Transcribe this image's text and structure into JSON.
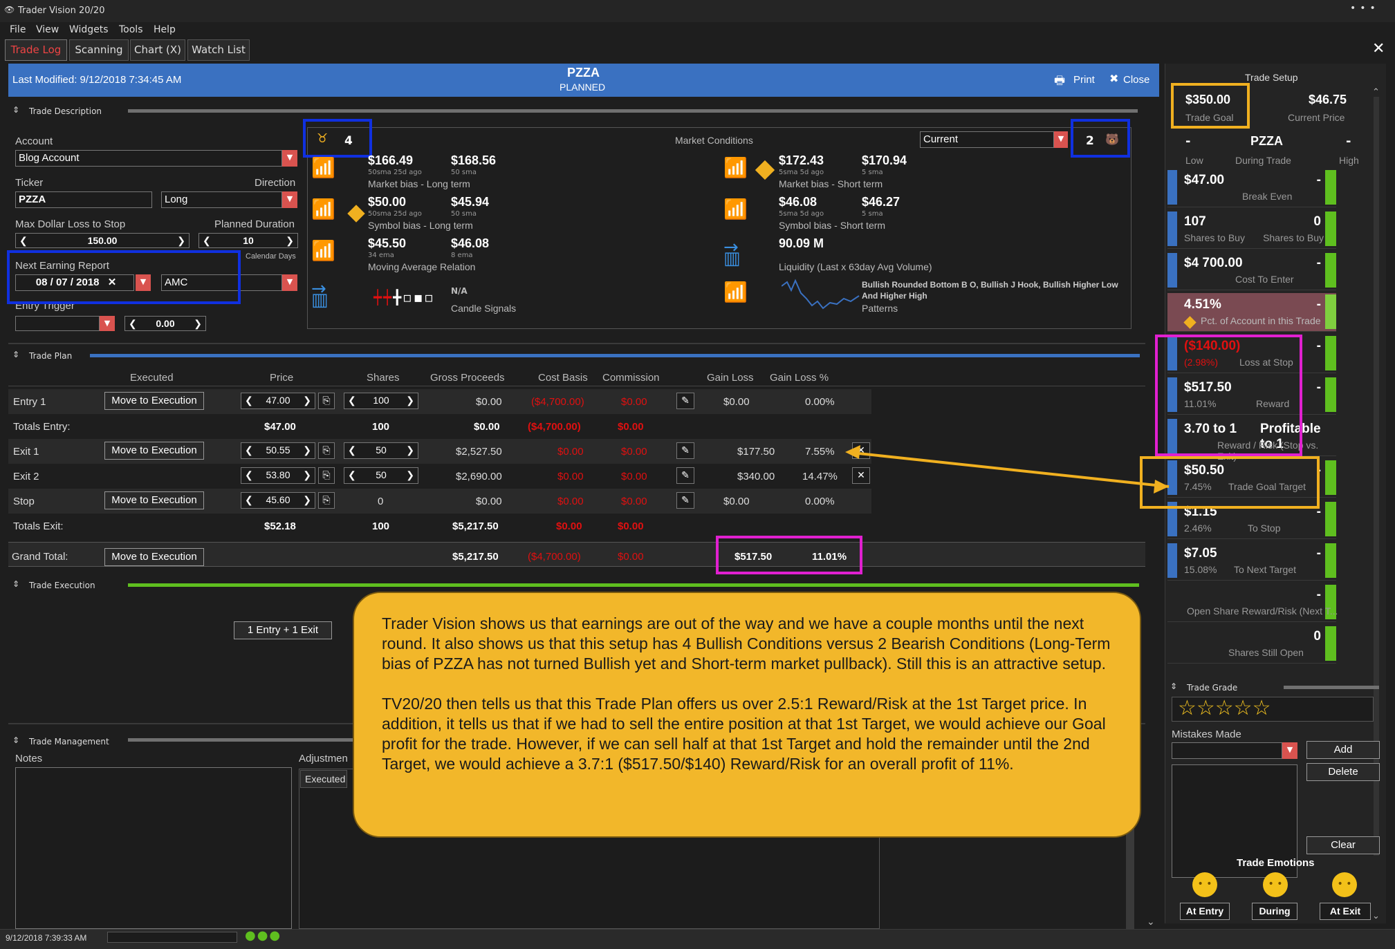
{
  "app": {
    "title": "Trader Vision 20/20"
  },
  "menu": [
    "File",
    "View",
    "Widgets",
    "Tools",
    "Help"
  ],
  "tabs": [
    "Trade Log",
    "Scanning",
    "Chart (X)",
    "Watch List"
  ],
  "header": {
    "last_modified": "Last Modified: 9/12/2018 7:34:45 AM",
    "ticker": "PZZA",
    "status": "PLANNED",
    "print": "Print",
    "close": "Close"
  },
  "trade_description": {
    "title": "Trade Description",
    "account_label": "Account",
    "account": "Blog Account",
    "ticker_label": "Ticker",
    "ticker": "PZZA",
    "direction_label": "Direction",
    "direction": "Long",
    "max_loss_label": "Max Dollar Loss to Stop",
    "max_loss": "150.00",
    "duration_label": "Planned Duration",
    "duration": "10",
    "duration_unit": "Calendar Days",
    "earning_label": "Next Earning Report",
    "earning_mm": "08",
    "earning_dd": "07",
    "earning_yyyy": "2018",
    "earning_time": "AMC",
    "entry_trigger_label": "Entry Trigger",
    "entry_trigger_value": "0.00"
  },
  "market_conditions": {
    "title": "Market Conditions",
    "bull_count": "4",
    "bear_count": "2",
    "period": "Current",
    "cells": [
      {
        "v1": "$166.49",
        "s1": "50sma 25d ago",
        "v2": "$168.56",
        "s2": "50 sma",
        "label": "Market bias - Long term"
      },
      {
        "v1": "$172.43",
        "s1": "5sma 5d ago",
        "v2": "$170.94",
        "s2": "5 sma",
        "label": "Market bias - Short term"
      },
      {
        "v1": "$50.00",
        "s1": "50sma 25d ago",
        "v2": "$45.94",
        "s2": "50 sma",
        "label": "Symbol bias - Long term"
      },
      {
        "v1": "$46.08",
        "s1": "5sma 5d ago",
        "v2": "$46.27",
        "s2": "5 sma",
        "label": "Symbol bias - Short term"
      },
      {
        "v1": "$45.50",
        "s1": "34 ema",
        "v2": "$46.08",
        "s2": "8 ema",
        "label": "Moving Average Relation"
      },
      {
        "v1": "90.09 M",
        "s1": "",
        "v2": "",
        "s2": "",
        "label": "Liquidity (Last x 63day Avg Volume)"
      },
      {
        "v1": "N/A",
        "label": "Candle Signals"
      },
      {
        "v1": "Bullish Rounded Bottom B O, Bullish J Hook, Bullish Higher Low And Higher High",
        "label": "Patterns"
      }
    ]
  },
  "trade_plan": {
    "title": "Trade Plan",
    "columns": [
      "Executed",
      "Price",
      "Shares",
      "Gross Proceeds",
      "Cost Basis",
      "Commission",
      "Gain Loss",
      "Gain Loss %"
    ],
    "move_btn": "Move to Execution",
    "rows": [
      {
        "label": "Entry 1",
        "price": "47.00",
        "shares": "100",
        "gross": "$0.00",
        "cost": "($4,700.00)",
        "comm": "$0.00",
        "gl": "$0.00",
        "glp": "0.00%"
      },
      {
        "label": "Totals Entry:",
        "price": "$47.00",
        "shares": "100",
        "gross": "$0.00",
        "cost": "($4,700.00)",
        "comm": "$0.00"
      },
      {
        "label": "Exit 1",
        "price": "50.55",
        "shares": "50",
        "gross": "$2,527.50",
        "cost": "$0.00",
        "comm": "$0.00",
        "gl": "$177.50",
        "glp": "7.55%"
      },
      {
        "label": "Exit 2",
        "price": "53.80",
        "shares": "50",
        "gross": "$2,690.00",
        "cost": "$0.00",
        "comm": "$0.00",
        "gl": "$340.00",
        "glp": "14.47%"
      },
      {
        "label": "Stop",
        "price": "45.60",
        "shares": "0",
        "gross": "$0.00",
        "cost": "$0.00",
        "comm": "$0.00",
        "gl": "$0.00",
        "glp": "0.00%"
      },
      {
        "label": "Totals Exit:",
        "price": "$52.18",
        "shares": "100",
        "gross": "$5,217.50",
        "cost": "$0.00",
        "comm": "$0.00"
      },
      {
        "label": "Grand Total:",
        "gross": "$5,217.50",
        "cost": "($4,700.00)",
        "comm": "$0.00",
        "gl": "$517.50",
        "glp": "11.01%"
      }
    ]
  },
  "trade_execution": {
    "title": "Trade Execution",
    "entry_exit_btn": "1 Entry + 1 Exit"
  },
  "trade_management": {
    "title": "Trade Management",
    "notes_label": "Notes",
    "adjust_label": "Adjustmen",
    "executed_label": "Executed"
  },
  "status_bar": {
    "time": "9/12/2018 7:39:33 AM"
  },
  "right_panel": {
    "title": "Trade Setup",
    "trade_goal": "$350.00",
    "trade_goal_label": "Trade Goal",
    "current_price": "$46.75",
    "current_price_label": "Current Price",
    "ticker": "PZZA",
    "low": "-",
    "high": "-",
    "low_label": "Low",
    "during_label": "During Trade",
    "high_label": "High",
    "rows": [
      {
        "v": "$47.00",
        "vr": "-",
        "s": "Break Even"
      },
      {
        "v": "107",
        "vr": "0",
        "sl": "Shares to Buy",
        "sr": "Shares to Buy"
      },
      {
        "v": "$4 700.00",
        "vr": "-",
        "s": "Cost To Enter"
      },
      {
        "v": "4.51%",
        "vr": "-",
        "s": "Pct. of Account in this Trade"
      },
      {
        "v": "($140.00)",
        "vr": "-",
        "sl": "(2.98%)",
        "s": "Loss at Stop"
      },
      {
        "v": "$517.50",
        "vr": "-",
        "sl": "11.01%",
        "s": "Reward"
      },
      {
        "v": "3.70 to 1",
        "vr": "Profitable to 1",
        "s": "Reward / Risk (Stop vs. Exit)"
      },
      {
        "v": "$50.50",
        "vr": "-",
        "sl": "7.45%",
        "s": "Trade Goal Target"
      },
      {
        "v": "$1.15",
        "vr": "-",
        "sl": "2.46%",
        "s": "To Stop"
      },
      {
        "v": "$7.05",
        "vr": "-",
        "sl": "15.08%",
        "s": "To Next Target"
      },
      {
        "v": "",
        "vr": "-",
        "s": "Open Share Reward/Risk (Next T..."
      },
      {
        "v": "",
        "vr": "0",
        "s": "Shares Still Open"
      }
    ],
    "trade_grade": "Trade Grade",
    "stars": "☆☆☆☆☆",
    "mistakes": "Mistakes Made",
    "add": "Add",
    "delete": "Delete",
    "clear": "Clear",
    "emotions": "Trade Emotions",
    "at_entry": "At Entry",
    "during": "During",
    "at_exit": "At Exit"
  },
  "callout": {
    "p1": "Trader Vision shows us that earnings are out of the way and we have a couple months until the next round.  It also shows us that this setup has 4 Bullish Conditions versus 2 Bearish Conditions (Long-Term bias of PZZA has not turned Bullish yet and Short-term market pullback).  Still this is an attractive setup.",
    "p2": "TV20/20 then tells us that this Trade Plan offers us over 2.5:1 Reward/Risk at the 1st Target price.  In addition, it tells us that if we had to sell the entire position at that 1st Target, we would achieve our Goal profit for the trade.  However, if we can sell half at that 1st Target and hold the remainder until the 2nd Target, we would achieve a 3.7:1 ($517.50/$140) Reward/Risk for an overall profit of 11%."
  },
  "colors": {
    "accent_blue": "#3a71c1",
    "bull_green": "#5fbf1f",
    "bear_red": "#e01010",
    "callout": "#f2b72a",
    "highlight_blue": "#1030e0",
    "highlight_magenta": "#e020d0",
    "highlight_gold": "#f0b020"
  }
}
